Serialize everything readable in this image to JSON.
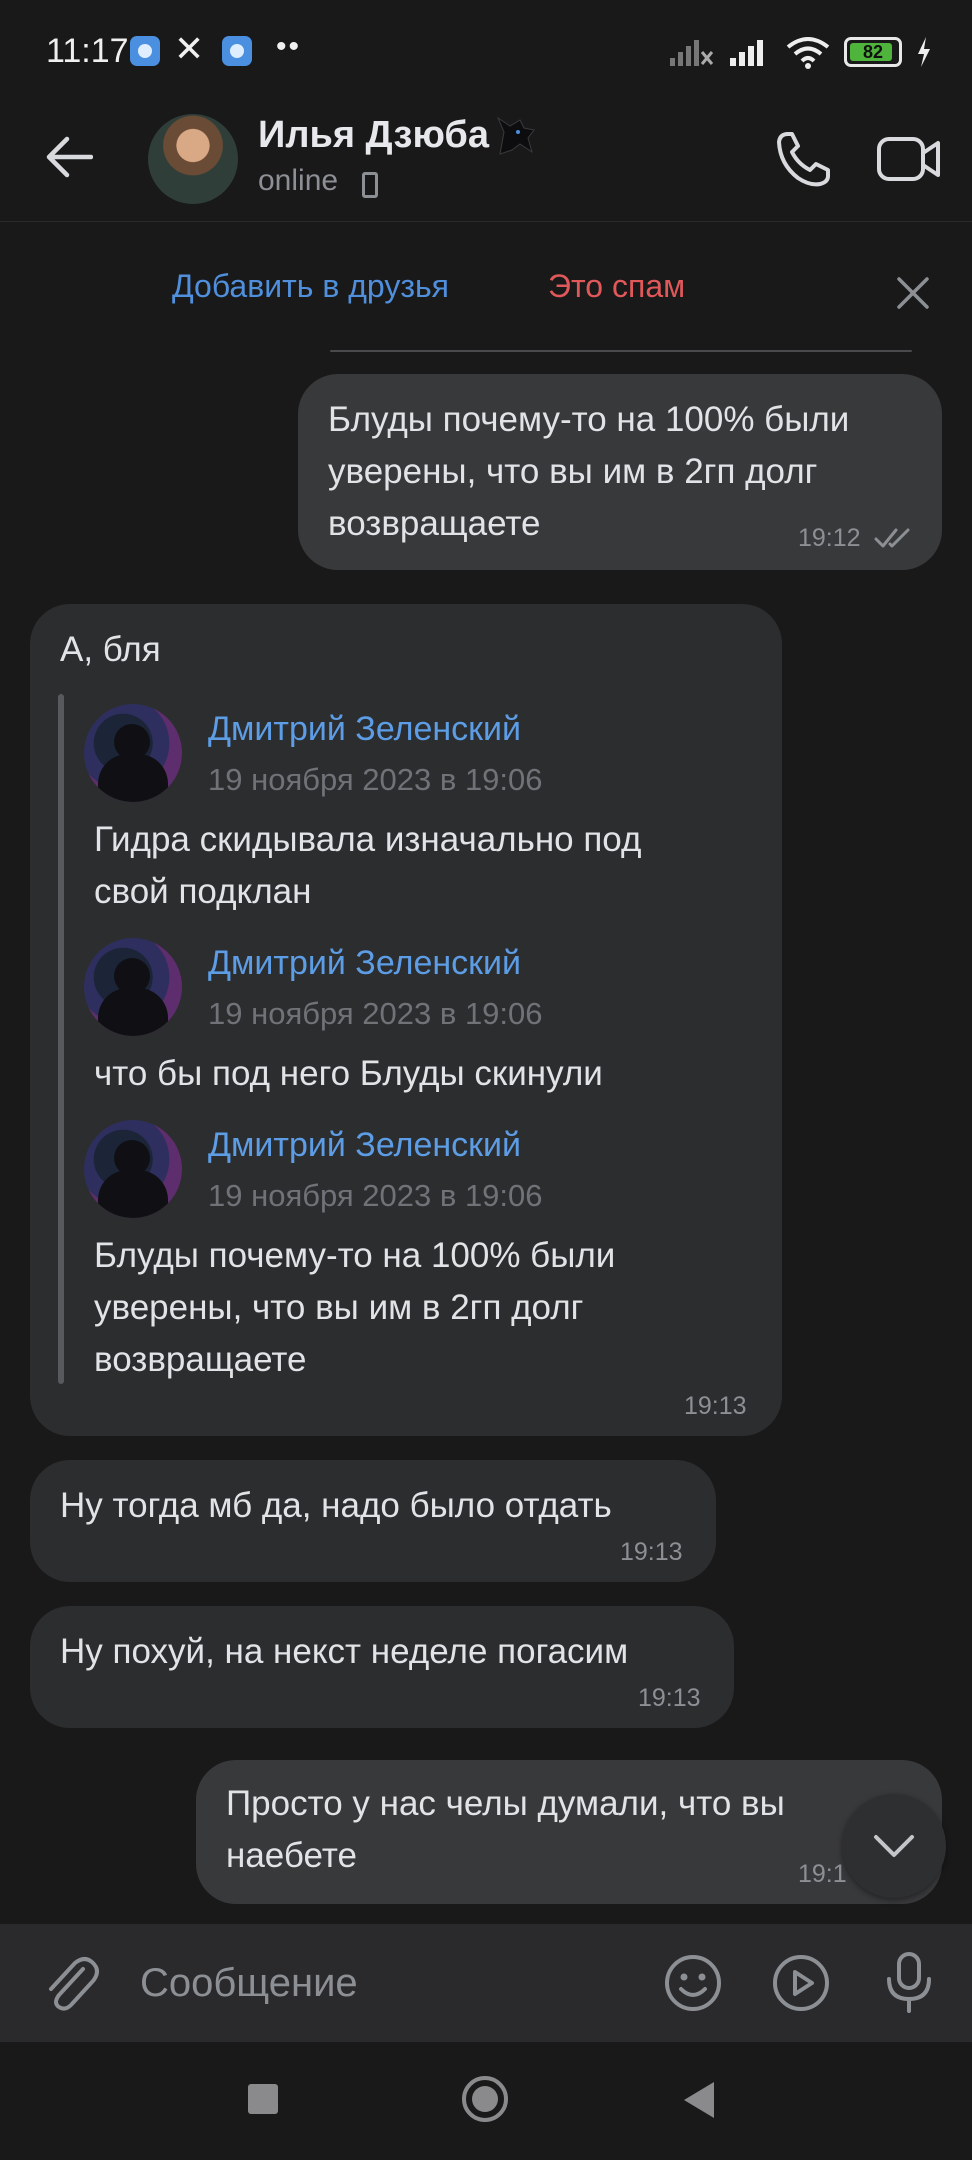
{
  "status_bar": {
    "time": "11:17",
    "battery": "82",
    "battery_level": 0.82,
    "battery_color": "#4fb43c",
    "icons": [
      "app-notification-icon",
      "x-icon",
      "app-notification-icon",
      "more-dots-icon",
      "signal-off-icon",
      "signal-icon",
      "wifi-icon",
      "battery-icon",
      "charging-icon"
    ]
  },
  "header": {
    "contact_name": "Илья Дзюба",
    "contact_status": "online",
    "icons": [
      "back-arrow-icon",
      "avatar",
      "wolf-emoji-icon",
      "mobile-device-icon",
      "phone-icon",
      "video-camera-icon"
    ]
  },
  "action_bar": {
    "add_friend": "Добавить в друзья",
    "spam": "Это спам",
    "accent_color": "#4f8fdc",
    "spam_color": "#e0585a"
  },
  "messages": [
    {
      "direction": "out",
      "lines": [
        "Блуды почему-то на 100% были",
        "уверены, что вы им в 2гп долг",
        "возвращаете"
      ],
      "time": "19:12",
      "read": true
    },
    {
      "direction": "in",
      "text": "А, бля",
      "time": "19:13",
      "forwarded": [
        {
          "author": "Дмитрий Зеленский",
          "date": "19 ноября 2023 в 19:06",
          "lines": [
            "Гидра скидывала изначально под",
            "свой подклан"
          ]
        },
        {
          "author": "Дмитрий Зеленский",
          "date": "19 ноября 2023 в 19:06",
          "lines": [
            "что бы под него Блуды скинули"
          ]
        },
        {
          "author": "Дмитрий Зеленский",
          "date": "19 ноября 2023 в 19:06",
          "lines": [
            "Блуды почему-то на 100% были",
            "уверены, что вы им в 2гп долг",
            "возвращаете"
          ]
        }
      ]
    },
    {
      "direction": "in",
      "text": "Ну тогда мб да, надо было отдать",
      "time": "19:13"
    },
    {
      "direction": "in",
      "text": "Ну похуй, на некст неделе погасим",
      "time": "19:13"
    },
    {
      "direction": "out",
      "lines": [
        "Просто у нас челы думали, что вы",
        "наебете"
      ],
      "time": "19:1"
    }
  ],
  "composer": {
    "placeholder": "Сообщение",
    "icons": [
      "attach-icon",
      "emoji-icon",
      "video-message-icon",
      "microphone-icon"
    ]
  },
  "nav_bar": {
    "icons": [
      "recent-apps-icon",
      "home-icon",
      "back-icon"
    ]
  }
}
